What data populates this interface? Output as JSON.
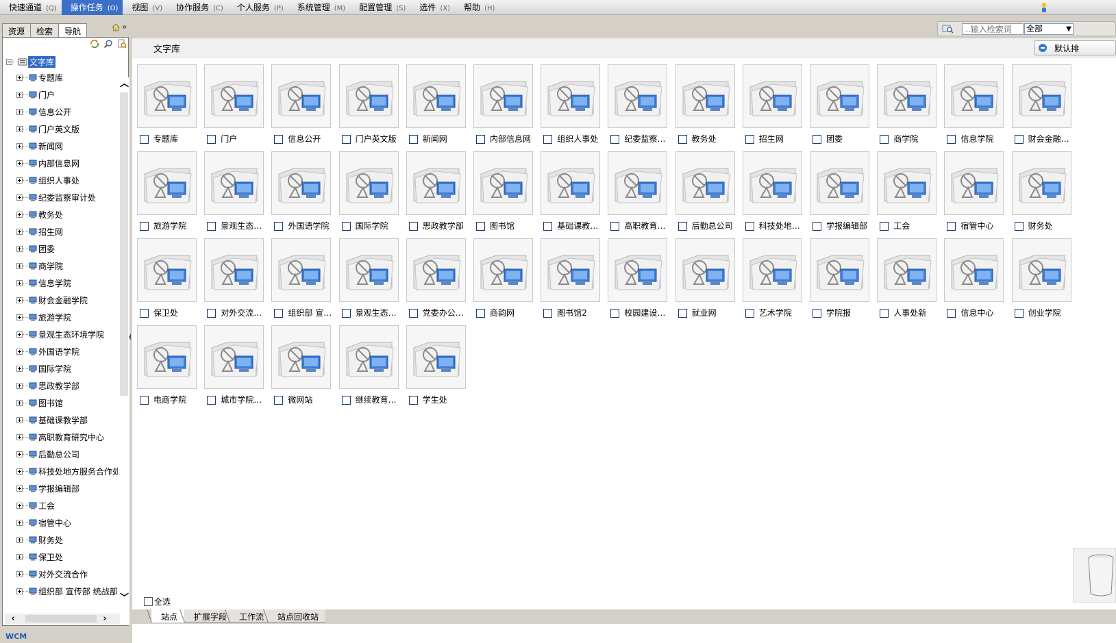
{
  "menu": {
    "items": [
      {
        "label": "快速通道",
        "hotkey": "(Q)"
      },
      {
        "label": "操作任务",
        "hotkey": "(O)",
        "active": true
      },
      {
        "label": "视图",
        "hotkey": "(V)"
      },
      {
        "label": "协作服务",
        "hotkey": "(C)"
      },
      {
        "label": "个人服务",
        "hotkey": "(P)"
      },
      {
        "label": "系统管理",
        "hotkey": "(M)"
      },
      {
        "label": "配置管理",
        "hotkey": "(S)"
      },
      {
        "label": "选件",
        "hotkey": "(X)"
      },
      {
        "label": "帮助",
        "hotkey": "(H)"
      }
    ]
  },
  "left": {
    "tabs": [
      "资源",
      "检索",
      "导航"
    ],
    "selected_tab": "导航",
    "double_arrow": "»",
    "tree_root": "文字库",
    "tree_items": [
      "专题库",
      "门户",
      "信息公开",
      "门户英文版",
      "新闻网",
      "内部信息网",
      "组织人事处",
      "纪委监察审计处",
      "教务处",
      "招生网",
      "团委",
      "商学院",
      "信息学院",
      "财会金融学院",
      "旅游学院",
      "景观生态环境学院",
      "外国语学院",
      "国际学院",
      "思政教学部",
      "图书馆",
      "基础课教学部",
      "高职教育研究中心",
      "后勤总公司",
      "科技处地方服务合作处",
      "学报编辑部",
      "工会",
      "宿管中心",
      "财务处",
      "保卫处",
      "对外交流合作",
      "组织部 宣传部 统战部"
    ],
    "logo_text": "WCM"
  },
  "search": {
    "placeholder": "..输入检索词",
    "scope": "全部"
  },
  "content": {
    "title": "文字库",
    "default_button": "默认排",
    "sites": [
      "专题库",
      "门户",
      "信息公开",
      "门户英文版",
      "新闻网",
      "内部信息网",
      "组织人事处",
      "纪委监察…",
      "教务处",
      "招生网",
      "团委",
      "商学院",
      "信息学院",
      "财会金融…",
      "旅游学院",
      "景观生态…",
      "外国语学院",
      "国际学院",
      "思政教学部",
      "图书馆",
      "基础课教…",
      "高职教育…",
      "后勤总公司",
      "科技处地…",
      "学报编辑部",
      "工会",
      "宿管中心",
      "财务处",
      "保卫处",
      "对外交流…",
      "组织部 宣…",
      "景观生态…",
      "党委办公…",
      "商韵网",
      "图书馆2",
      "校园建设…",
      "就业网",
      "艺术学院",
      "学院报",
      "人事处新",
      "信息中心",
      "创业学院",
      "电商学院",
      "城市学院…",
      "微网站",
      "继续教育…",
      "学生处"
    ],
    "select_all": "全选",
    "bottom_tabs": [
      "站点",
      "扩展字段",
      "工作流",
      "站点回收站"
    ]
  }
}
